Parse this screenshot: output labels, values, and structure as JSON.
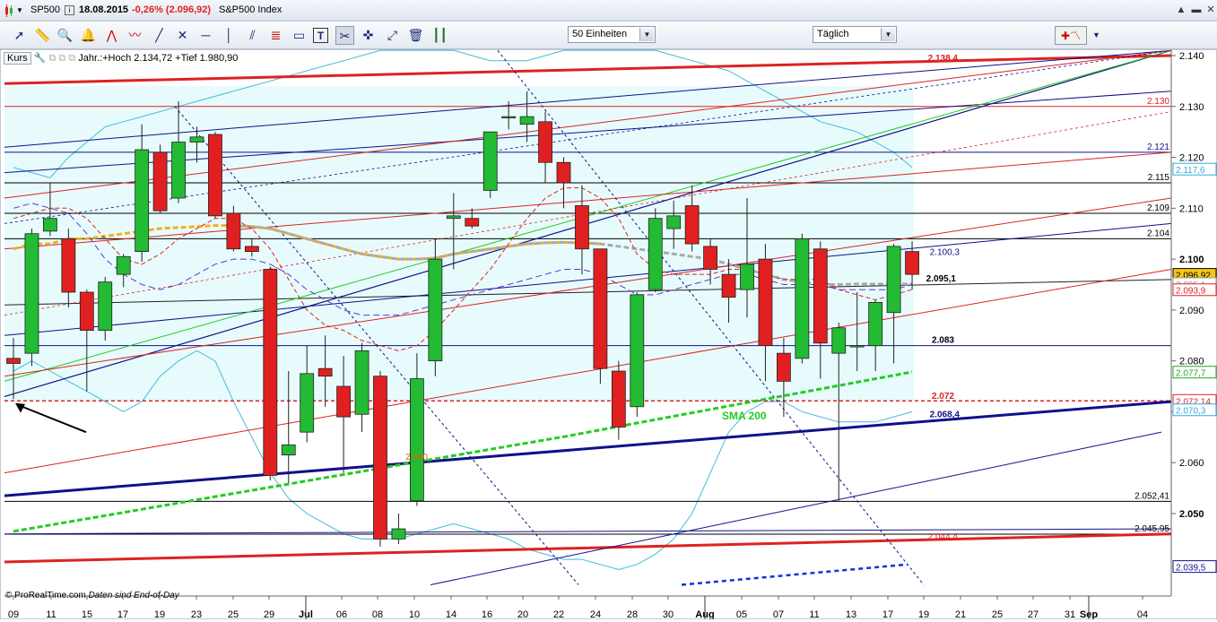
{
  "titlebar": {
    "symbol": "SP500",
    "date": "18.08.2015",
    "change": "-0,26% (2.096,92)",
    "name": "S&P500 Index"
  },
  "toolbar": {
    "units_select": "50 Einheiten",
    "period_select": "Täglich",
    "tools": [
      "candle-icon",
      "ruler-icon",
      "zoom-icon",
      "alarm-icon",
      "fan-icon",
      "wave-icon",
      "trendline-icon",
      "trendline-cross-icon",
      "hline-icon",
      "vline-icon",
      "parallel-icon",
      "fibo-icon",
      "rectangle-icon",
      "text-tool-icon",
      "tools-icon",
      "arrow-cross-icon",
      "trash-icon",
      "fibo-lines-icon"
    ]
  },
  "chart_header": {
    "kurs": "Kurs",
    "info": "Jahr.:+Hoch 2.134,72 +Tief 1.980,90"
  },
  "footer": {
    "brand": "© ProRealTime.com",
    "note": "Daten sind End-of-Day"
  },
  "colors": {
    "bull": "#22bb33",
    "bear": "#e02020",
    "channel_red": "#dd2222",
    "channel_blue": "#10108a",
    "band": "#44bbdd",
    "sma200": "#22cc22",
    "band_fill": "#e8fbfc"
  },
  "chart_data": {
    "type": "candlestick",
    "ylim": [
      2036,
      2142
    ],
    "y_ticks": [
      "2.140",
      "2.130",
      "2.120",
      "2.110",
      "2.100",
      "2.090",
      "2.080",
      "2.070",
      "2.060",
      "2.050"
    ],
    "x_ticks": [
      "09",
      "11",
      "15",
      "17",
      "19",
      "23",
      "25",
      "29",
      "Jul",
      "06",
      "08",
      "10",
      "14",
      "16",
      "20",
      "22",
      "24",
      "28",
      "30",
      "Aug",
      "05",
      "07",
      "11",
      "13",
      "17",
      "19",
      "21",
      "25",
      "27",
      "31",
      "Sep",
      "04"
    ],
    "candles": [
      {
        "o": 2080.5,
        "h": 2084.5,
        "l": 2072.5,
        "c": 2079.5
      },
      {
        "o": 2081.5,
        "h": 2106,
        "l": 2079,
        "c": 2105
      },
      {
        "o": 2105.5,
        "h": 2115,
        "l": 2104.5,
        "c": 2108
      },
      {
        "o": 2104,
        "h": 2106,
        "l": 2090.5,
        "c": 2093.5
      },
      {
        "o": 2093.5,
        "h": 2094,
        "l": 2074,
        "c": 2086
      },
      {
        "o": 2086,
        "h": 2096.5,
        "l": 2084,
        "c": 2095.5
      },
      {
        "o": 2097,
        "h": 2101,
        "l": 2094.5,
        "c": 2100.5
      },
      {
        "o": 2101.5,
        "h": 2126.5,
        "l": 2099.5,
        "c": 2121.5
      },
      {
        "o": 2121,
        "h": 2122.5,
        "l": 2109,
        "c": 2109.5
      },
      {
        "o": 2112,
        "h": 2131,
        "l": 2111,
        "c": 2123
      },
      {
        "o": 2123,
        "h": 2126,
        "l": 2119,
        "c": 2124
      },
      {
        "o": 2124.5,
        "h": 2125,
        "l": 2108,
        "c": 2108.5
      },
      {
        "o": 2109,
        "h": 2110.5,
        "l": 2101.5,
        "c": 2102
      },
      {
        "o": 2102.5,
        "h": 2104,
        "l": 2100.5,
        "c": 2101.5
      },
      {
        "o": 2098,
        "h": 2098.5,
        "l": 2056.5,
        "c": 2057.5
      },
      {
        "o": 2061.5,
        "h": 2078,
        "l": 2056,
        "c": 2063.5
      },
      {
        "o": 2066,
        "h": 2083,
        "l": 2064,
        "c": 2077.5
      },
      {
        "o": 2078.5,
        "h": 2085,
        "l": 2071,
        "c": 2077
      },
      {
        "o": 2075,
        "h": 2081,
        "l": 2058,
        "c": 2069
      },
      {
        "o": 2069.5,
        "h": 2083.5,
        "l": 2066,
        "c": 2082
      },
      {
        "o": 2077,
        "h": 2078,
        "l": 2043.5,
        "c": 2045
      },
      {
        "o": 2045,
        "h": 2050,
        "l": 2044,
        "c": 2047
      },
      {
        "o": 2052.5,
        "h": 2081.5,
        "l": 2051.5,
        "c": 2076.5
      },
      {
        "o": 2080,
        "h": 2104,
        "l": 2077,
        "c": 2100
      },
      {
        "o": 2108,
        "h": 2113,
        "l": 2098,
        "c": 2108.5
      },
      {
        "o": 2108,
        "h": 2110,
        "l": 2106,
        "c": 2106.5
      },
      {
        "o": 2113.5,
        "h": 2123,
        "l": 2112,
        "c": 2125
      },
      {
        "o": 2128,
        "h": 2131,
        "l": 2125.5,
        "c": 2128
      },
      {
        "o": 2126.5,
        "h": 2133,
        "l": 2123,
        "c": 2128
      },
      {
        "o": 2127,
        "h": 2129,
        "l": 2115,
        "c": 2119
      },
      {
        "o": 2119,
        "h": 2120,
        "l": 2110,
        "c": 2115
      },
      {
        "o": 2110.5,
        "h": 2114.5,
        "l": 2097,
        "c": 2102
      },
      {
        "o": 2102,
        "h": 2102,
        "l": 2075.5,
        "c": 2078.5
      },
      {
        "o": 2078,
        "h": 2080,
        "l": 2064.5,
        "c": 2067
      },
      {
        "o": 2071,
        "h": 2093.5,
        "l": 2069,
        "c": 2093
      },
      {
        "o": 2094,
        "h": 2110,
        "l": 2093.5,
        "c": 2108
      },
      {
        "o": 2106,
        "h": 2111.5,
        "l": 2102,
        "c": 2108.5
      },
      {
        "o": 2110.5,
        "h": 2114.5,
        "l": 2101.5,
        "c": 2103
      },
      {
        "o": 2102.5,
        "h": 2104,
        "l": 2095,
        "c": 2098
      },
      {
        "o": 2097,
        "h": 2100,
        "l": 2087.5,
        "c": 2092.5
      },
      {
        "o": 2094,
        "h": 2112,
        "l": 2088.5,
        "c": 2099
      },
      {
        "o": 2100,
        "h": 2103,
        "l": 2076,
        "c": 2083
      },
      {
        "o": 2081.5,
        "h": 2084.5,
        "l": 2069,
        "c": 2076
      },
      {
        "o": 2080.5,
        "h": 2105,
        "l": 2079.5,
        "c": 2104
      },
      {
        "o": 2102,
        "h": 2103.5,
        "l": 2076.5,
        "c": 2083.5
      },
      {
        "o": 2081.5,
        "h": 2087.5,
        "l": 2052.5,
        "c": 2086.5
      },
      {
        "o": 2083,
        "h": 2093.5,
        "l": 2078,
        "c": 2083
      },
      {
        "o": 2083,
        "h": 2092,
        "l": 2078,
        "c": 2091.5
      },
      {
        "o": 2089.5,
        "h": 2103,
        "l": 2079.5,
        "c": 2102.5
      },
      {
        "o": 2101.5,
        "h": 2103.5,
        "l": 2094,
        "c": 2097
      }
    ],
    "annotations": [
      {
        "text": "2.138,4",
        "y": 2138.4,
        "color": "#dd2222"
      },
      {
        "text": "2.130",
        "y": 2130,
        "color": "#dd2222"
      },
      {
        "text": "2.121",
        "y": 2121,
        "color": "#10108a"
      },
      {
        "text": "2.115",
        "y": 2115,
        "color": "#000000"
      },
      {
        "text": "2.109",
        "y": 2109,
        "color": "#000000"
      },
      {
        "text": "2.104",
        "y": 2104,
        "color": "#000000"
      },
      {
        "text": "2.100,3",
        "y": 2100.3,
        "color": "#10108a"
      },
      {
        "text": "2.095,1",
        "y": 2095.1,
        "color": "#000000"
      },
      {
        "text": "2.083",
        "y": 2083,
        "color": "#000000"
      },
      {
        "text": "2.072",
        "y": 2072,
        "color": "#dd2222"
      },
      {
        "text": "2.068,4",
        "y": 2068.4,
        "color": "#10108a"
      },
      {
        "text": "2.052,41",
        "y": 2052.41,
        "color": "#000000"
      },
      {
        "text": "2.045,95",
        "y": 2045.95,
        "color": "#000000"
      },
      {
        "text": "2.044,4",
        "y": 2044.4,
        "color": "#dd2222"
      },
      {
        "text": "2.060",
        "y": 2060,
        "color": "#dd6600"
      }
    ],
    "price_tags": [
      {
        "text": "2.117,6",
        "y": 2117.6,
        "color": "#33aadd",
        "fill": "#ffffff"
      },
      {
        "text": "2.096,92",
        "y": 2096.92,
        "color": "#000000",
        "fill": "#f5c518"
      },
      {
        "text": "2.095,1",
        "y": 2095.1,
        "color": "#999999",
        "fill": "#ffffff"
      },
      {
        "text": "2.093,9",
        "y": 2093.9,
        "color": "#dd2222",
        "fill": "#ffffff"
      },
      {
        "text": "2.077,7",
        "y": 2077.7,
        "color": "#22aa22",
        "fill": "#ffffff"
      },
      {
        "text": "2.072,14",
        "y": 2072.14,
        "color": "#dd2222",
        "fill": "#ffffff"
      },
      {
        "text": "2.070,3",
        "y": 2070.3,
        "color": "#33aadd",
        "fill": "#ffffff"
      },
      {
        "text": "2.039,5",
        "y": 2039.5,
        "color": "#10108a",
        "fill": "#ffffff"
      }
    ],
    "labels": {
      "sma": "SMA 200"
    }
  }
}
